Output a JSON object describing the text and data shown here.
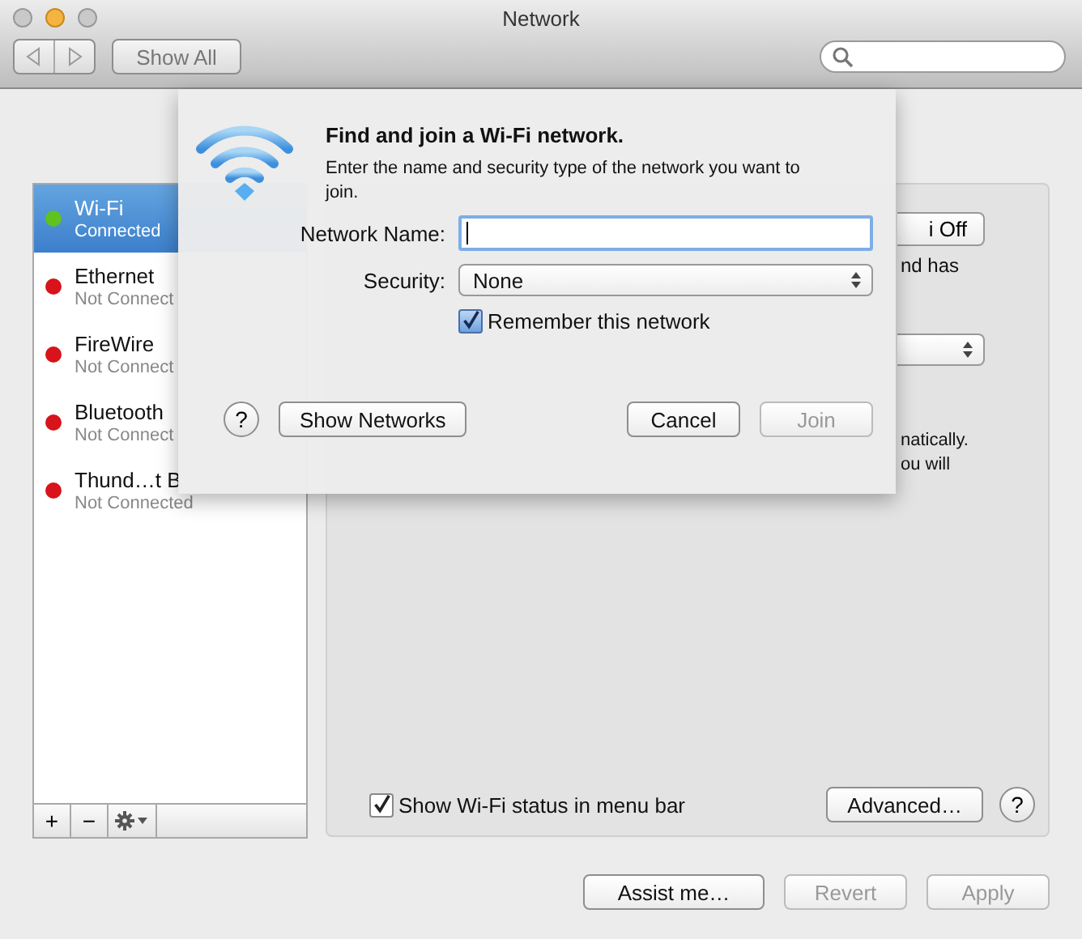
{
  "window": {
    "title": "Network"
  },
  "toolbar": {
    "show_all": "Show All"
  },
  "sidebar": {
    "items": [
      {
        "name": "Wi-Fi",
        "status": "Connected",
        "color": "#5fc21f",
        "selected": true
      },
      {
        "name": "Ethernet",
        "status": "Not Connect",
        "color": "#d8131b",
        "selected": false
      },
      {
        "name": "FireWire",
        "status": "Not Connect",
        "color": "#d8131b",
        "selected": false
      },
      {
        "name": "Bluetooth",
        "status": "Not Connect",
        "color": "#d8131b",
        "selected": false
      },
      {
        "name": "Thund…t B",
        "status": "Not Connected",
        "color": "#d8131b",
        "selected": false
      }
    ],
    "add": "+",
    "remove": "−"
  },
  "panel": {
    "wifi_button_fragment": "i Off",
    "status_fragment": "nd has",
    "note_fragments": [
      "natically.",
      "ou will"
    ],
    "show_status": {
      "label": "Show Wi-Fi status in menu bar",
      "checked": true
    },
    "advanced": "Advanced…",
    "help": "?"
  },
  "footer": {
    "buttons": [
      {
        "label": "Assist me…",
        "disabled": false
      },
      {
        "label": "Revert",
        "disabled": true
      },
      {
        "label": "Apply",
        "disabled": true
      }
    ]
  },
  "sheet": {
    "title": "Find and join a Wi-Fi network.",
    "description": "Enter the name and security type of the network you want to join.",
    "network_name_label": "Network Name:",
    "security_label": "Security:",
    "security_value": "None",
    "remember": {
      "label": "Remember this network",
      "checked": true
    },
    "help": "?",
    "show_networks": "Show Networks",
    "buttons": [
      {
        "label": "Cancel",
        "disabled": false
      },
      {
        "label": "Join",
        "disabled": true
      }
    ]
  }
}
